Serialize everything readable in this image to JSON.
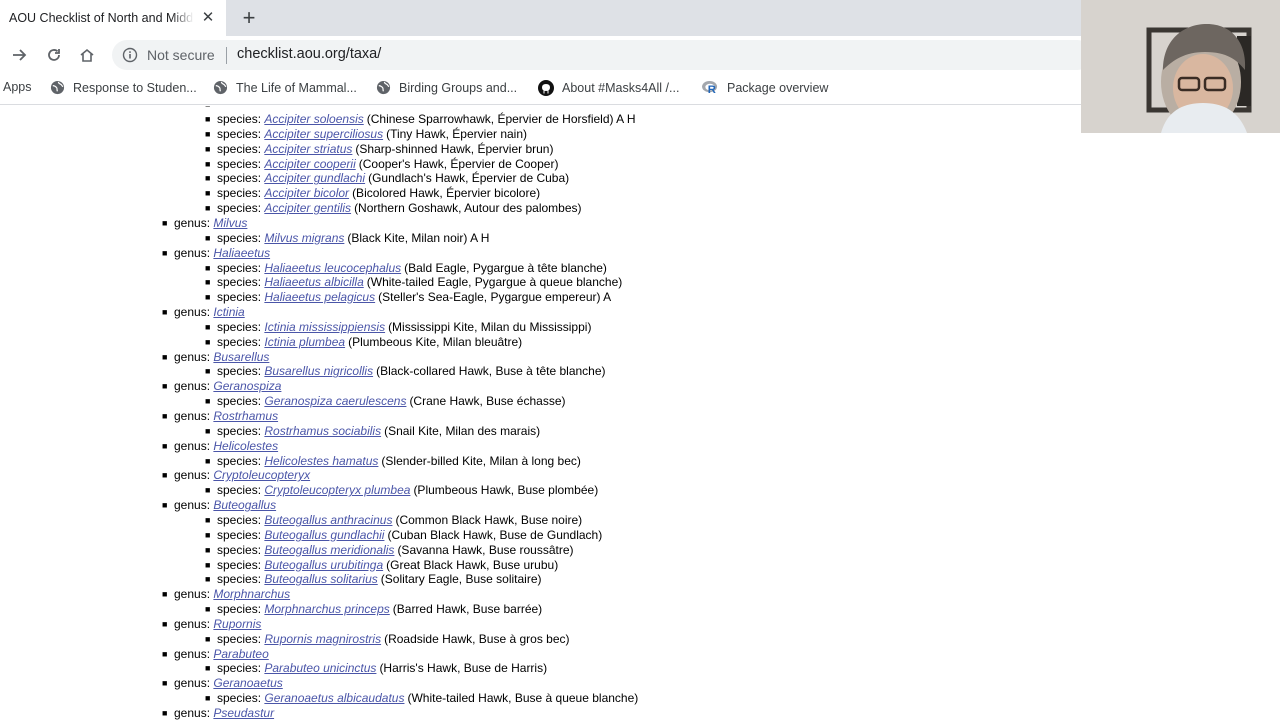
{
  "browser": {
    "tab_title": "AOU Checklist of North and Middle American Birds",
    "close_glyph": "✕",
    "new_tab_glyph": "+",
    "not_secure": "Not secure",
    "url": "checklist.aou.org/taxa/",
    "bookmarks": [
      "Apps",
      "Response to Studen...",
      "The Life of Mammal...",
      "Birding Groups and...",
      "About #Masks4All /...",
      "Package overview"
    ]
  },
  "labels": {
    "genus": "genus:",
    "species": "species:"
  },
  "entries": [
    {
      "level": "species",
      "name": "Accipiter soloensis",
      "common": "(Chinese Sparrowhawk, Épervier de Horsfield) A H"
    },
    {
      "level": "species",
      "name": "Accipiter superciliosus",
      "common": "(Tiny Hawk, Épervier nain)"
    },
    {
      "level": "species",
      "name": "Accipiter striatus",
      "common": "(Sharp-shinned Hawk, Épervier brun)"
    },
    {
      "level": "species",
      "name": "Accipiter cooperii",
      "common": "(Cooper's Hawk, Épervier de Cooper)"
    },
    {
      "level": "species",
      "name": "Accipiter gundlachi",
      "common": "(Gundlach's Hawk, Épervier de Cuba)"
    },
    {
      "level": "species",
      "name": "Accipiter bicolor",
      "common": "(Bicolored Hawk, Épervier bicolore)"
    },
    {
      "level": "species",
      "name": "Accipiter gentilis",
      "common": "(Northern Goshawk, Autour des palombes)"
    },
    {
      "level": "genus",
      "name": "Milvus"
    },
    {
      "level": "species",
      "name": "Milvus migrans",
      "common": "(Black Kite, Milan noir) A H"
    },
    {
      "level": "genus",
      "name": "Haliaeetus"
    },
    {
      "level": "species",
      "name": "Haliaeetus leucocephalus",
      "common": "(Bald Eagle, Pygargue à tête blanche)"
    },
    {
      "level": "species",
      "name": "Haliaeetus albicilla",
      "common": "(White-tailed Eagle, Pygargue à queue blanche)"
    },
    {
      "level": "species",
      "name": "Haliaeetus pelagicus",
      "common": "(Steller's Sea-Eagle, Pygargue empereur) A"
    },
    {
      "level": "genus",
      "name": "Ictinia"
    },
    {
      "level": "species",
      "name": "Ictinia mississippiensis",
      "common": "(Mississippi Kite, Milan du Mississippi)"
    },
    {
      "level": "species",
      "name": "Ictinia plumbea",
      "common": "(Plumbeous Kite, Milan bleuâtre)"
    },
    {
      "level": "genus",
      "name": "Busarellus"
    },
    {
      "level": "species",
      "name": "Busarellus nigricollis",
      "common": "(Black-collared Hawk, Buse à tête blanche)"
    },
    {
      "level": "genus",
      "name": "Geranospiza"
    },
    {
      "level": "species",
      "name": "Geranospiza caerulescens",
      "common": "(Crane Hawk, Buse échasse)"
    },
    {
      "level": "genus",
      "name": "Rostrhamus"
    },
    {
      "level": "species",
      "name": "Rostrhamus sociabilis",
      "common": "(Snail Kite, Milan des marais)"
    },
    {
      "level": "genus",
      "name": "Helicolestes"
    },
    {
      "level": "species",
      "name": "Helicolestes hamatus",
      "common": "(Slender-billed Kite, Milan à long bec)"
    },
    {
      "level": "genus",
      "name": "Cryptoleucopteryx"
    },
    {
      "level": "species",
      "name": "Cryptoleucopteryx plumbea",
      "common": "(Plumbeous Hawk, Buse plombée)"
    },
    {
      "level": "genus",
      "name": "Buteogallus"
    },
    {
      "level": "species",
      "name": "Buteogallus anthracinus",
      "common": "(Common Black Hawk, Buse noire)"
    },
    {
      "level": "species",
      "name": "Buteogallus gundlachii",
      "common": "(Cuban Black Hawk, Buse de Gundlach)"
    },
    {
      "level": "species",
      "name": "Buteogallus meridionalis",
      "common": "(Savanna Hawk, Buse roussâtre)"
    },
    {
      "level": "species",
      "name": "Buteogallus urubitinga",
      "common": "(Great Black Hawk, Buse urubu)"
    },
    {
      "level": "species",
      "name": "Buteogallus solitarius",
      "common": "(Solitary Eagle, Buse solitaire)"
    },
    {
      "level": "genus",
      "name": "Morphnarchus"
    },
    {
      "level": "species",
      "name": "Morphnarchus princeps",
      "common": "(Barred Hawk, Buse barrée)"
    },
    {
      "level": "genus",
      "name": "Rupornis"
    },
    {
      "level": "species",
      "name": "Rupornis magnirostris",
      "common": "(Roadside Hawk, Buse à gros bec)"
    },
    {
      "level": "genus",
      "name": "Parabuteo"
    },
    {
      "level": "species",
      "name": "Parabuteo unicinctus",
      "common": "(Harris's Hawk, Buse de Harris)"
    },
    {
      "level": "genus",
      "name": "Geranoaetus"
    },
    {
      "level": "species",
      "name": "Geranoaetus albicaudatus",
      "common": "(White-tailed Hawk, Buse à queue blanche)"
    },
    {
      "level": "genus",
      "name": "Pseudastur"
    }
  ]
}
